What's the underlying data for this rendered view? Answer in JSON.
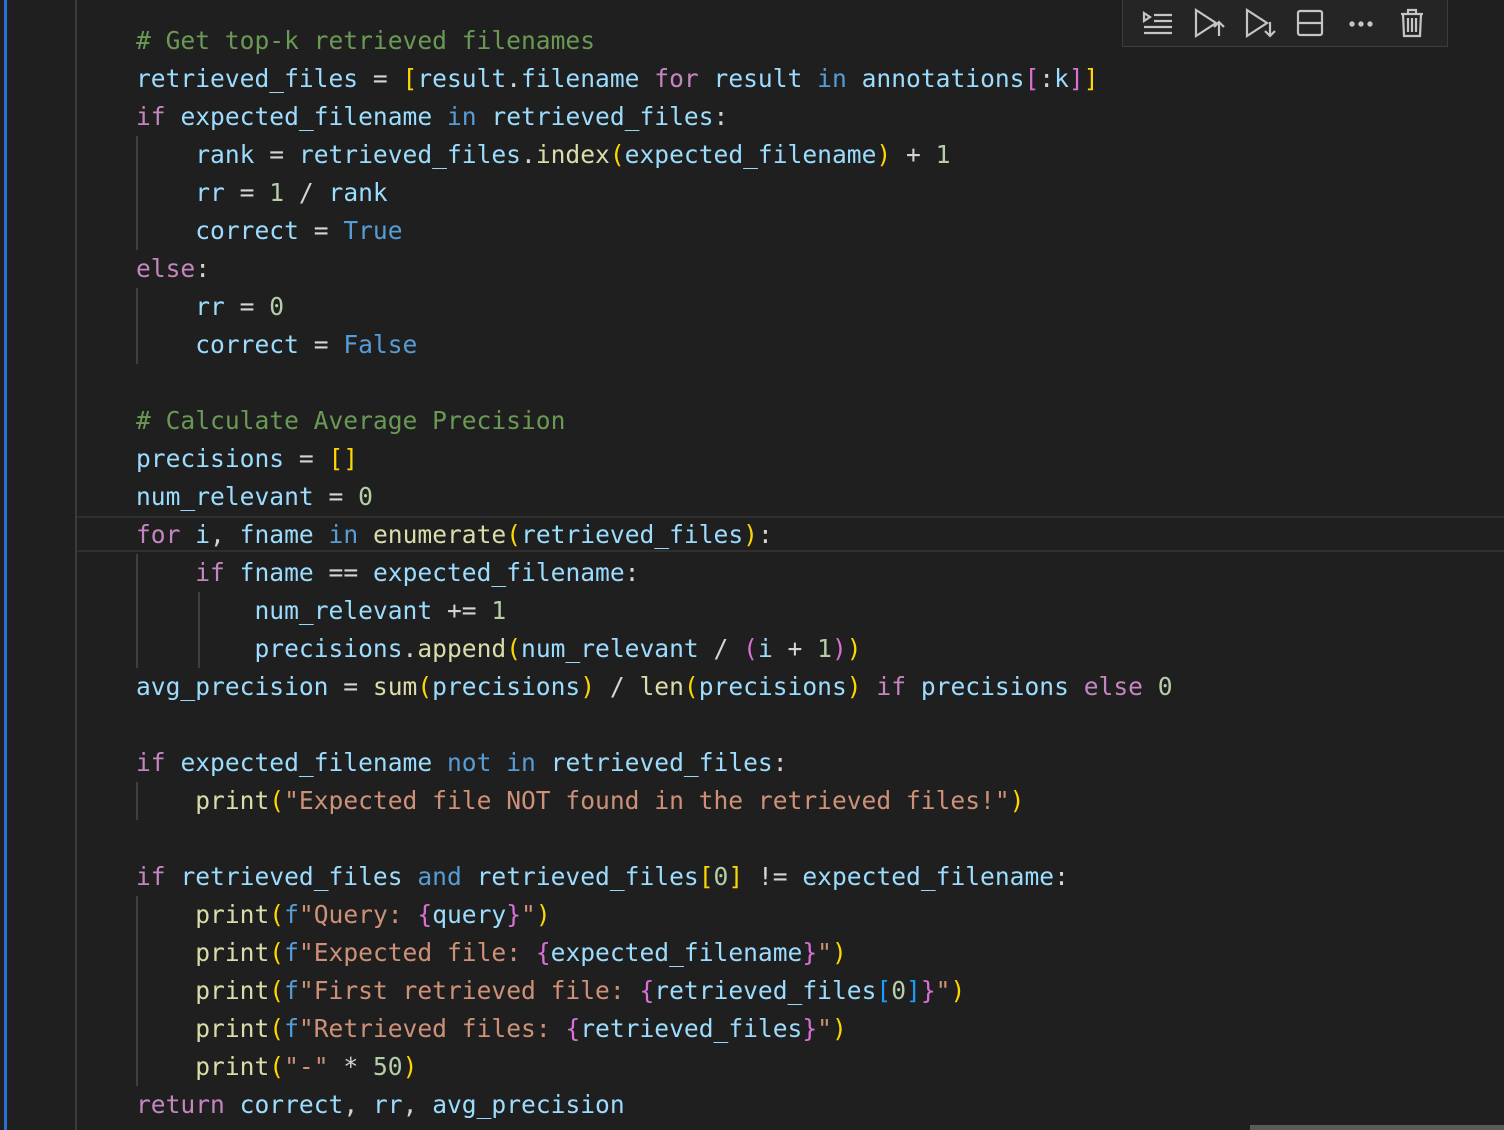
{
  "toolbar": {
    "items": [
      {
        "icon": "run-by-line-icon",
        "label": "Run by line"
      },
      {
        "icon": "execute-above-icon",
        "label": "Execute above cells"
      },
      {
        "icon": "execute-below-icon",
        "label": "Execute cell and below"
      },
      {
        "icon": "split-cell-icon",
        "label": "Split cell"
      },
      {
        "icon": "more-actions-icon",
        "label": "More actions"
      },
      {
        "icon": "delete-cell-icon",
        "label": "Delete cell"
      }
    ]
  },
  "colors": {
    "background": "#1f1f1f",
    "keyword": "#569cd6",
    "control": "#c586c0",
    "variable": "#9cdcfe",
    "function": "#dcdcaa",
    "string": "#ce9178",
    "number": "#b5cea8",
    "comment": "#6a9955",
    "cell_indicator": "#2b6fd6"
  },
  "code": {
    "language": "python",
    "lines": [
      [
        [
          "com",
          "# Get top-k retrieved filenames"
        ]
      ],
      [
        [
          "var",
          "retrieved_files"
        ],
        [
          "op",
          " = "
        ],
        [
          "br1",
          "["
        ],
        [
          "var",
          "result"
        ],
        [
          "op",
          "."
        ],
        [
          "var",
          "filename"
        ],
        [
          "op",
          " "
        ],
        [
          "ctrl",
          "for"
        ],
        [
          "op",
          " "
        ],
        [
          "var",
          "result"
        ],
        [
          "op",
          " "
        ],
        [
          "kw",
          "in"
        ],
        [
          "op",
          " "
        ],
        [
          "var",
          "annotations"
        ],
        [
          "br2",
          "["
        ],
        [
          "op",
          ":"
        ],
        [
          "var",
          "k"
        ],
        [
          "br2",
          "]"
        ],
        [
          "br1",
          "]"
        ]
      ],
      [
        [
          "ctrl",
          "if"
        ],
        [
          "op",
          " "
        ],
        [
          "var",
          "expected_filename"
        ],
        [
          "op",
          " "
        ],
        [
          "kw",
          "in"
        ],
        [
          "op",
          " "
        ],
        [
          "var",
          "retrieved_files"
        ],
        [
          "op",
          ":"
        ]
      ],
      [
        [
          "op",
          "    "
        ],
        [
          "var",
          "rank"
        ],
        [
          "op",
          " = "
        ],
        [
          "var",
          "retrieved_files"
        ],
        [
          "op",
          "."
        ],
        [
          "fn",
          "index"
        ],
        [
          "br1",
          "("
        ],
        [
          "var",
          "expected_filename"
        ],
        [
          "br1",
          ")"
        ],
        [
          "op",
          " + "
        ],
        [
          "num",
          "1"
        ]
      ],
      [
        [
          "op",
          "    "
        ],
        [
          "var",
          "rr"
        ],
        [
          "op",
          " = "
        ],
        [
          "num",
          "1"
        ],
        [
          "op",
          " / "
        ],
        [
          "var",
          "rank"
        ]
      ],
      [
        [
          "op",
          "    "
        ],
        [
          "var",
          "correct"
        ],
        [
          "op",
          " = "
        ],
        [
          "const",
          "True"
        ]
      ],
      [
        [
          "ctrl",
          "else"
        ],
        [
          "op",
          ":"
        ]
      ],
      [
        [
          "op",
          "    "
        ],
        [
          "var",
          "rr"
        ],
        [
          "op",
          " = "
        ],
        [
          "num",
          "0"
        ]
      ],
      [
        [
          "op",
          "    "
        ],
        [
          "var",
          "correct"
        ],
        [
          "op",
          " = "
        ],
        [
          "const",
          "False"
        ]
      ],
      [],
      [
        [
          "com",
          "# Calculate Average Precision"
        ]
      ],
      [
        [
          "var",
          "precisions"
        ],
        [
          "op",
          " = "
        ],
        [
          "br1",
          "[]"
        ]
      ],
      [
        [
          "var",
          "num_relevant"
        ],
        [
          "op",
          " = "
        ],
        [
          "num",
          "0"
        ]
      ],
      [
        [
          "ctrl",
          "for"
        ],
        [
          "op",
          " "
        ],
        [
          "var",
          "i"
        ],
        [
          "op",
          ", "
        ],
        [
          "var",
          "fname"
        ],
        [
          "op",
          " "
        ],
        [
          "kw",
          "in"
        ],
        [
          "op",
          " "
        ],
        [
          "fn",
          "enumerate"
        ],
        [
          "br1",
          "("
        ],
        [
          "var",
          "retrieved_files"
        ],
        [
          "br1",
          ")"
        ],
        [
          "op",
          ":"
        ]
      ],
      [
        [
          "op",
          "    "
        ],
        [
          "ctrl",
          "if"
        ],
        [
          "op",
          " "
        ],
        [
          "var",
          "fname"
        ],
        [
          "op",
          " == "
        ],
        [
          "var",
          "expected_filename"
        ],
        [
          "op",
          ":"
        ]
      ],
      [
        [
          "op",
          "        "
        ],
        [
          "var",
          "num_relevant"
        ],
        [
          "op",
          " += "
        ],
        [
          "num",
          "1"
        ]
      ],
      [
        [
          "op",
          "        "
        ],
        [
          "var",
          "precisions"
        ],
        [
          "op",
          "."
        ],
        [
          "fn",
          "append"
        ],
        [
          "br1",
          "("
        ],
        [
          "var",
          "num_relevant"
        ],
        [
          "op",
          " / "
        ],
        [
          "br2",
          "("
        ],
        [
          "var",
          "i"
        ],
        [
          "op",
          " + "
        ],
        [
          "num",
          "1"
        ],
        [
          "br2",
          ")"
        ],
        [
          "br1",
          ")"
        ]
      ],
      [
        [
          "var",
          "avg_precision"
        ],
        [
          "op",
          " = "
        ],
        [
          "fn",
          "sum"
        ],
        [
          "br1",
          "("
        ],
        [
          "var",
          "precisions"
        ],
        [
          "br1",
          ")"
        ],
        [
          "op",
          " / "
        ],
        [
          "fn",
          "len"
        ],
        [
          "br1",
          "("
        ],
        [
          "var",
          "precisions"
        ],
        [
          "br1",
          ")"
        ],
        [
          "op",
          " "
        ],
        [
          "ctrl",
          "if"
        ],
        [
          "op",
          " "
        ],
        [
          "var",
          "precisions"
        ],
        [
          "op",
          " "
        ],
        [
          "ctrl",
          "else"
        ],
        [
          "op",
          " "
        ],
        [
          "num",
          "0"
        ]
      ],
      [],
      [
        [
          "ctrl",
          "if"
        ],
        [
          "op",
          " "
        ],
        [
          "var",
          "expected_filename"
        ],
        [
          "op",
          " "
        ],
        [
          "kw",
          "not"
        ],
        [
          "op",
          " "
        ],
        [
          "kw",
          "in"
        ],
        [
          "op",
          " "
        ],
        [
          "var",
          "retrieved_files"
        ],
        [
          "op",
          ":"
        ]
      ],
      [
        [
          "op",
          "    "
        ],
        [
          "fn",
          "print"
        ],
        [
          "br1",
          "("
        ],
        [
          "str",
          "\"Expected file NOT found in the retrieved files!\""
        ],
        [
          "br1",
          ")"
        ]
      ],
      [],
      [
        [
          "ctrl",
          "if"
        ],
        [
          "op",
          " "
        ],
        [
          "var",
          "retrieved_files"
        ],
        [
          "op",
          " "
        ],
        [
          "kw",
          "and"
        ],
        [
          "op",
          " "
        ],
        [
          "var",
          "retrieved_files"
        ],
        [
          "br1",
          "["
        ],
        [
          "num",
          "0"
        ],
        [
          "br1",
          "]"
        ],
        [
          "op",
          " != "
        ],
        [
          "var",
          "expected_filename"
        ],
        [
          "op",
          ":"
        ]
      ],
      [
        [
          "op",
          "    "
        ],
        [
          "fn",
          "print"
        ],
        [
          "br1",
          "("
        ],
        [
          "kw",
          "f"
        ],
        [
          "str",
          "\"Query: "
        ],
        [
          "br2",
          "{"
        ],
        [
          "var",
          "query"
        ],
        [
          "br2",
          "}"
        ],
        [
          "str",
          "\""
        ],
        [
          "br1",
          ")"
        ]
      ],
      [
        [
          "op",
          "    "
        ],
        [
          "fn",
          "print"
        ],
        [
          "br1",
          "("
        ],
        [
          "kw",
          "f"
        ],
        [
          "str",
          "\"Expected file: "
        ],
        [
          "br2",
          "{"
        ],
        [
          "var",
          "expected_filename"
        ],
        [
          "br2",
          "}"
        ],
        [
          "str",
          "\""
        ],
        [
          "br1",
          ")"
        ]
      ],
      [
        [
          "op",
          "    "
        ],
        [
          "fn",
          "print"
        ],
        [
          "br1",
          "("
        ],
        [
          "kw",
          "f"
        ],
        [
          "str",
          "\"First retrieved file: "
        ],
        [
          "br2",
          "{"
        ],
        [
          "var",
          "retrieved_files"
        ],
        [
          "br3",
          "["
        ],
        [
          "num",
          "0"
        ],
        [
          "br3",
          "]"
        ],
        [
          "br2",
          "}"
        ],
        [
          "str",
          "\""
        ],
        [
          "br1",
          ")"
        ]
      ],
      [
        [
          "op",
          "    "
        ],
        [
          "fn",
          "print"
        ],
        [
          "br1",
          "("
        ],
        [
          "kw",
          "f"
        ],
        [
          "str",
          "\"Retrieved files: "
        ],
        [
          "br2",
          "{"
        ],
        [
          "var",
          "retrieved_files"
        ],
        [
          "br2",
          "}"
        ],
        [
          "str",
          "\""
        ],
        [
          "br1",
          ")"
        ]
      ],
      [
        [
          "op",
          "    "
        ],
        [
          "fn",
          "print"
        ],
        [
          "br1",
          "("
        ],
        [
          "str",
          "\"-\""
        ],
        [
          "op",
          " * "
        ],
        [
          "num",
          "50"
        ],
        [
          "br1",
          ")"
        ]
      ],
      [
        [
          "ctrl",
          "return"
        ],
        [
          "op",
          " "
        ],
        [
          "var",
          "correct"
        ],
        [
          "op",
          ", "
        ],
        [
          "var",
          "rr"
        ],
        [
          "op",
          ", "
        ],
        [
          "var",
          "avg_precision"
        ]
      ]
    ]
  }
}
